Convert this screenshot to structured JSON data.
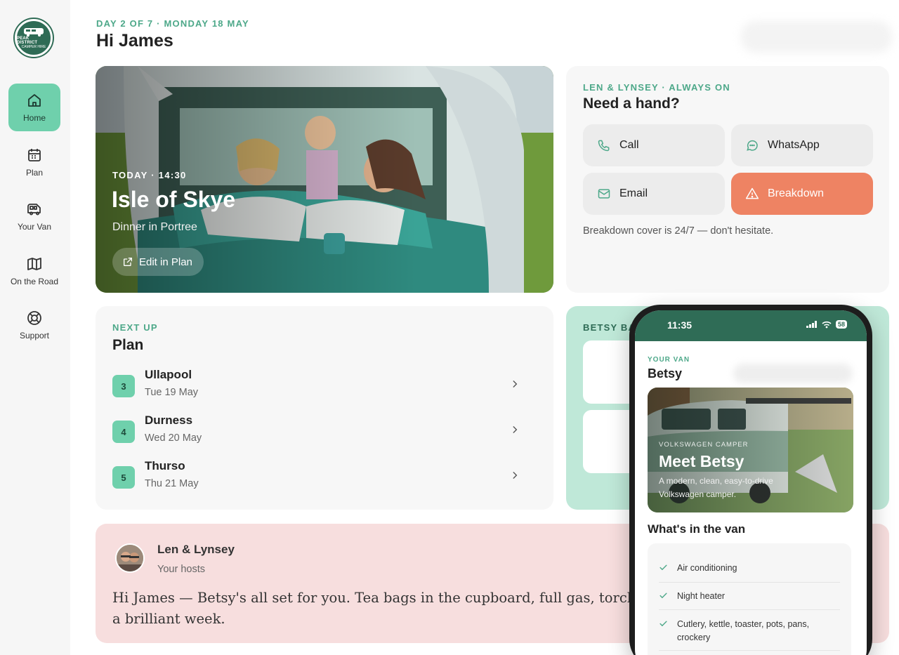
{
  "brand": {
    "logo_line1": "PEAK DISTRICT",
    "logo_line2": "CAMPER HIRE"
  },
  "sidebar": {
    "items": [
      {
        "label": "Home",
        "icon": "home-icon",
        "active": true
      },
      {
        "label": "Plan",
        "icon": "calendar-icon",
        "active": false
      },
      {
        "label": "Your Van",
        "icon": "van-icon",
        "active": false
      },
      {
        "label": "On the Road",
        "icon": "map-icon",
        "active": false
      },
      {
        "label": "Support",
        "icon": "lifebuoy-icon",
        "active": false
      }
    ]
  },
  "header": {
    "eyebrow": "DAY 2 OF 7 · MONDAY 18 MAY",
    "greeting": "Hi James"
  },
  "hero": {
    "eyebrow": "TODAY · 14:30",
    "title": "Isle of Skye",
    "subtitle": "Dinner in Portree",
    "button": "Edit in Plan"
  },
  "help": {
    "eyebrow": "LEN & LYNSEY · ALWAYS ON",
    "title": "Need a hand?",
    "buttons": {
      "call": "Call",
      "whatsapp": "WhatsApp",
      "email": "Email",
      "breakdown": "Breakdown"
    },
    "note": "Breakdown cover is 24/7 — don't hesitate."
  },
  "plan": {
    "eyebrow": "NEXT UP",
    "title": "Plan",
    "items": [
      {
        "day": "3",
        "name": "Ullapool",
        "date": "Tue 19 May"
      },
      {
        "day": "4",
        "name": "Durness",
        "date": "Wed 20 May"
      },
      {
        "day": "5",
        "name": "Thurso",
        "date": "Thu 21 May"
      }
    ]
  },
  "bag": {
    "eyebrow": "BETSY BA"
  },
  "message": {
    "name": "Len & Lynsey",
    "role": "Your hosts",
    "text": "Hi James — Betsy's all set for you. Tea bags in the cupboard, full gas, torch in a brilliant week."
  },
  "phone": {
    "time": "11:35",
    "battery": "58",
    "eyebrow": "YOUR VAN",
    "title": "Betsy",
    "hero_eyebrow": "VOLKSWAGEN CAMPER",
    "hero_title": "Meet Betsy",
    "hero_subtitle": "A modern, clean, easy-to-drive Volkswagen camper.",
    "section_title": "What's in the van",
    "features": [
      "Air conditioning",
      "Night heater",
      "Cutlery, kettle, toaster, pots, pans, crockery"
    ]
  },
  "colors": {
    "accent": "#6fd0ac",
    "brand_dark": "#2f6c56",
    "breakdown": "#ee8363",
    "message_bg": "#f7dede",
    "bag_bg": "#bfe8d8"
  }
}
